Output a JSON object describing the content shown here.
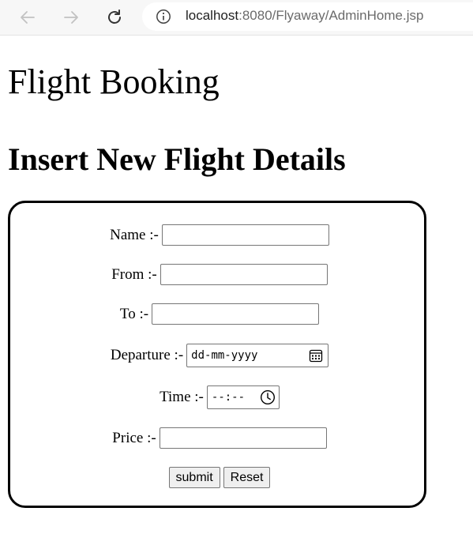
{
  "browser": {
    "url_host": "localhost",
    "url_rest": ":8080/Flyaway/AdminHome.jsp"
  },
  "page": {
    "title": "Flight Booking",
    "section_title": "Insert New Flight Details"
  },
  "form": {
    "name_label": "Name :-",
    "from_label": "From :-",
    "to_label": "To :-",
    "departure_label": "Departure :-",
    "departure_placeholder": "dd-mm-yyyy",
    "time_label": "Time :-",
    "time_placeholder": "--:--",
    "price_label": "Price :-",
    "submit_label": "submit",
    "reset_label": "Reset"
  },
  "icons": {
    "back": "arrow-left-icon",
    "forward": "arrow-right-icon",
    "reload": "reload-icon",
    "info": "info-icon",
    "calendar": "calendar-icon",
    "clock": "clock-icon"
  }
}
